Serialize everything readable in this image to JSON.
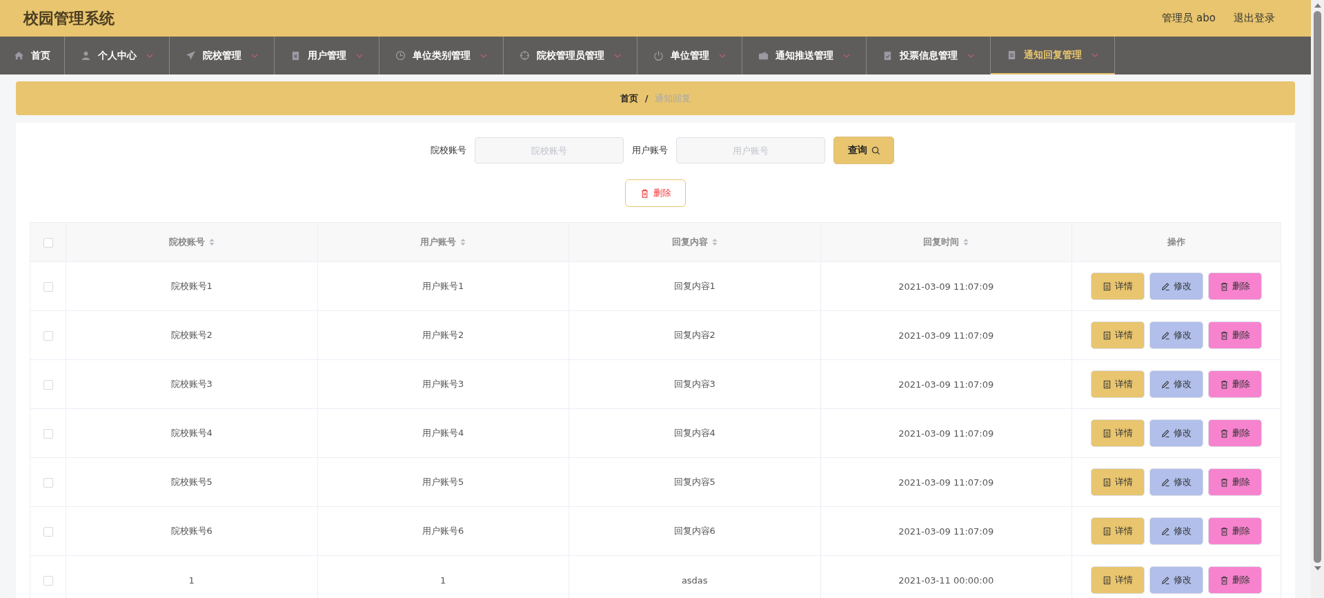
{
  "header": {
    "title": "校园管理系统",
    "user": "管理员 abo",
    "logout": "退出登录"
  },
  "nav": [
    {
      "label": "首页",
      "selected": false,
      "dropdown": false
    },
    {
      "label": "个人中心",
      "selected": false,
      "dropdown": true
    },
    {
      "label": "院校管理",
      "selected": false,
      "dropdown": true
    },
    {
      "label": "用户管理",
      "selected": false,
      "dropdown": true
    },
    {
      "label": "单位类别管理",
      "selected": false,
      "dropdown": true
    },
    {
      "label": "院校管理员管理",
      "selected": false,
      "dropdown": true
    },
    {
      "label": "单位管理",
      "selected": false,
      "dropdown": true
    },
    {
      "label": "通知推送管理",
      "selected": false,
      "dropdown": true
    },
    {
      "label": "投票信息管理",
      "selected": false,
      "dropdown": true
    },
    {
      "label": "通知回复管理",
      "selected": true,
      "dropdown": true
    }
  ],
  "breadcrumb": {
    "home": "首页",
    "separator": "/",
    "current": "通知回复"
  },
  "search": {
    "fields": [
      {
        "label": "院校账号",
        "placeholder": "院校账号"
      },
      {
        "label": "用户账号",
        "placeholder": "用户账号"
      }
    ],
    "button": "查询",
    "delete_button": "删除"
  },
  "table": {
    "header_checked": false,
    "columns": [
      {
        "title": "院校账号",
        "sortable": true
      },
      {
        "title": "用户账号",
        "sortable": true
      },
      {
        "title": "回复内容",
        "sortable": true
      },
      {
        "title": "回复时间",
        "sortable": true
      },
      {
        "title": "操作",
        "sortable": false
      }
    ],
    "rows": [
      {
        "checked": false,
        "cells": [
          "院校账号1",
          "用户账号1",
          "回复内容1",
          "2021-03-09 11:07:09"
        ],
        "actions": [
          {
            "kind": "detail",
            "label": "详情"
          },
          {
            "kind": "edit",
            "label": "修改"
          },
          {
            "kind": "delete",
            "label": "删除"
          }
        ]
      },
      {
        "checked": false,
        "cells": [
          "院校账号2",
          "用户账号2",
          "回复内容2",
          "2021-03-09 11:07:09"
        ],
        "actions": [
          {
            "kind": "detail",
            "label": "详情"
          },
          {
            "kind": "edit",
            "label": "修改"
          },
          {
            "kind": "delete",
            "label": "删除"
          }
        ]
      },
      {
        "checked": false,
        "cells": [
          "院校账号3",
          "用户账号3",
          "回复内容3",
          "2021-03-09 11:07:09"
        ],
        "actions": [
          {
            "kind": "detail",
            "label": "详情"
          },
          {
            "kind": "edit",
            "label": "修改"
          },
          {
            "kind": "delete",
            "label": "删除"
          }
        ]
      },
      {
        "checked": false,
        "cells": [
          "院校账号4",
          "用户账号4",
          "回复内容4",
          "2021-03-09 11:07:09"
        ],
        "actions": [
          {
            "kind": "detail",
            "label": "详情"
          },
          {
            "kind": "edit",
            "label": "修改"
          },
          {
            "kind": "delete",
            "label": "删除"
          }
        ]
      },
      {
        "checked": false,
        "cells": [
          "院校账号5",
          "用户账号5",
          "回复内容5",
          "2021-03-09 11:07:09"
        ],
        "actions": [
          {
            "kind": "detail",
            "label": "详情"
          },
          {
            "kind": "edit",
            "label": "修改"
          },
          {
            "kind": "delete",
            "label": "删除"
          }
        ]
      },
      {
        "checked": false,
        "cells": [
          "院校账号6",
          "用户账号6",
          "回复内容6",
          "2021-03-09 11:07:09"
        ],
        "actions": [
          {
            "kind": "detail",
            "label": "详情"
          },
          {
            "kind": "edit",
            "label": "修改"
          },
          {
            "kind": "delete",
            "label": "删除"
          }
        ]
      },
      {
        "checked": false,
        "cells": [
          "1",
          "1",
          "asdas",
          "2021-03-11 00:00:00"
        ],
        "actions": [
          {
            "kind": "detail",
            "label": "详情"
          },
          {
            "kind": "edit",
            "label": "修改"
          },
          {
            "kind": "delete",
            "label": "删除"
          }
        ]
      }
    ]
  }
}
